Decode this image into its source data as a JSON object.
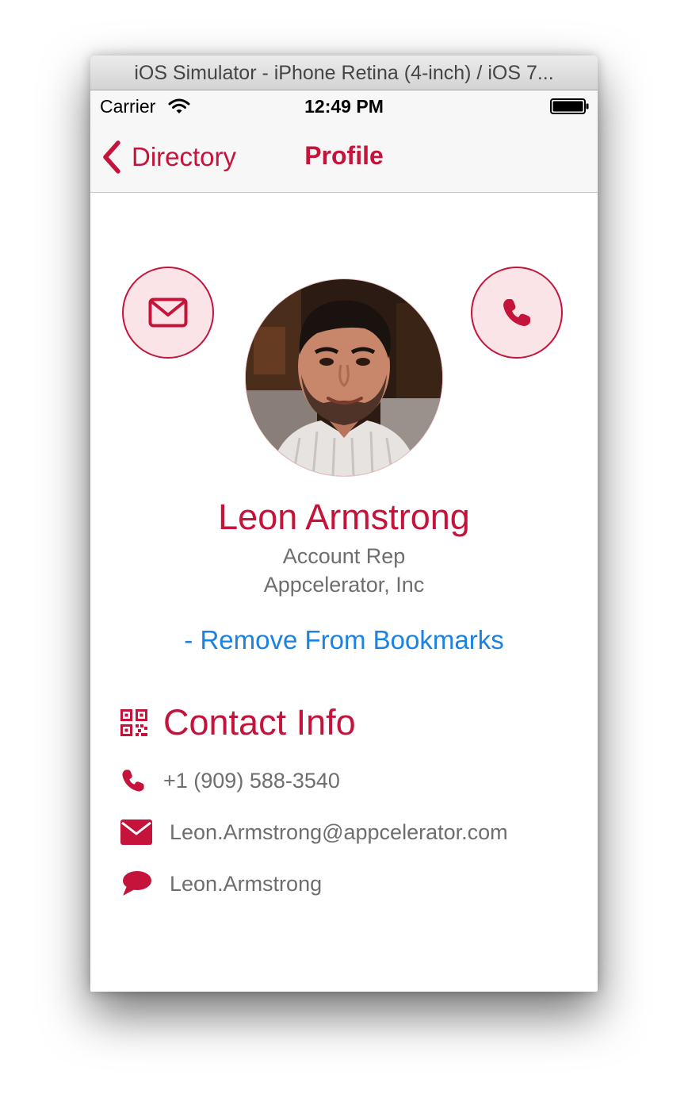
{
  "window": {
    "title": "iOS Simulator - iPhone Retina (4-inch) / iOS 7..."
  },
  "status_bar": {
    "carrier": "Carrier",
    "time": "12:49 PM",
    "icons": [
      "wifi-icon",
      "battery-icon"
    ]
  },
  "nav_bar": {
    "back_label": "Directory",
    "title": "Profile"
  },
  "profile": {
    "name": "Leon Armstrong",
    "job_title": "Account Rep",
    "company": "Appcelerator, Inc",
    "bookmark_action": "- Remove From Bookmarks",
    "action_buttons": [
      "envelope-icon",
      "phone-icon"
    ]
  },
  "contact_info": {
    "section_title": "Contact Info",
    "section_icon": "qr-code-icon",
    "items": [
      {
        "icon": "phone-icon",
        "value": "+1 (909) 588-3540"
      },
      {
        "icon": "envelope-icon",
        "value": "Leon.Armstrong@appcelerator.com"
      },
      {
        "icon": "chat-bubble-icon",
        "value": "Leon.Armstrong"
      }
    ]
  },
  "colors": {
    "accent": "#c4143b",
    "accent_light": "#fae4e8",
    "link": "#1a82e2",
    "secondary_text": "#6e6e6e"
  }
}
